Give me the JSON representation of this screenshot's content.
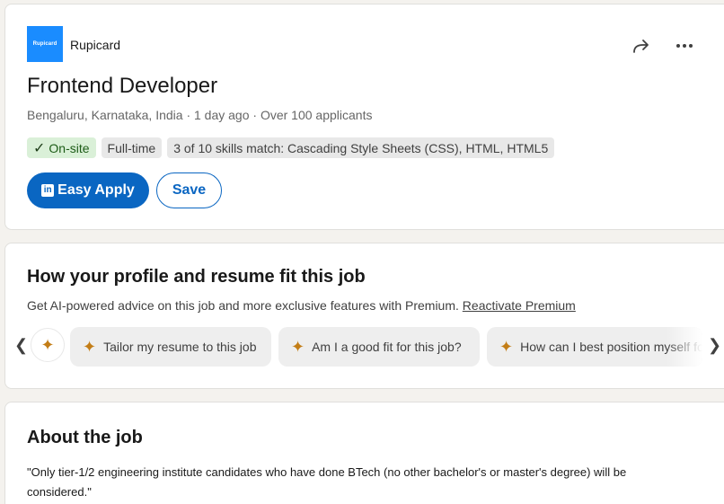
{
  "job": {
    "logo_text": "Rupicard",
    "company": "Rupicard",
    "title": "Frontend Developer",
    "meta": "Bengaluru, Karnataka, India · 1 day ago · Over 100 applicants",
    "pills": {
      "onsite": "On-site",
      "fulltime": "Full-time",
      "skills": "3 of 10 skills match: Cascading Style Sheets (CSS), HTML, HTML5"
    },
    "apply_label": "Easy Apply",
    "save_label": "Save",
    "icons": {
      "share": "share-icon",
      "more": "more-icon",
      "check": "check-icon"
    }
  },
  "fit": {
    "heading": "How your profile and resume fit this job",
    "subtext": "Get AI-powered advice on this job and more exclusive features with Premium.",
    "link": "Reactivate Premium",
    "chips": [
      "Tailor my resume to this job",
      "Am I a good fit for this job?",
      "How can I best position myself for this job?"
    ],
    "colors": {
      "spark": "#c37d16"
    }
  },
  "about": {
    "heading": "About the job",
    "text": "\"Only tier-1/2 engineering institute candidates who have done BTech (no other bachelor's or master's degree) will be considered.\""
  },
  "colors": {
    "primary": "#0a66c2",
    "onsite_bg": "#daf0d8",
    "logo_bg": "#1a8cff"
  }
}
